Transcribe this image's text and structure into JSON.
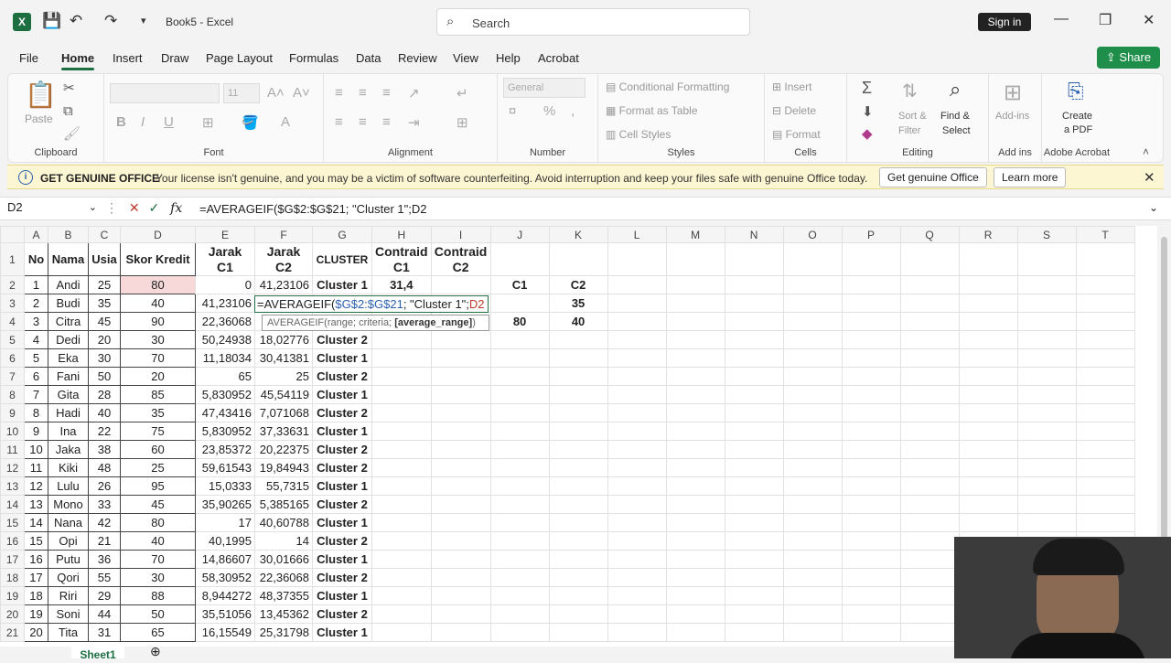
{
  "app": {
    "logo": "X",
    "title": "Book5  -  Excel",
    "search_placeholder": "Search",
    "sign_in": "Sign in"
  },
  "menu": [
    "File",
    "Home",
    "Insert",
    "Draw",
    "Page Layout",
    "Formulas",
    "Data",
    "Review",
    "View",
    "Help",
    "Acrobat"
  ],
  "share": "Share",
  "ribbon": {
    "clipboard": {
      "paste": "Paste",
      "label": "Clipboard"
    },
    "font": {
      "size": "11",
      "bold": "B",
      "italic": "I",
      "underline": "U",
      "label": "Font"
    },
    "alignment": {
      "label": "Alignment"
    },
    "number": {
      "format": "General",
      "label": "Number"
    },
    "styles": {
      "conditional": "Conditional Formatting",
      "table": "Format as Table",
      "cell": "Cell Styles",
      "label": "Styles"
    },
    "cells": {
      "insert": "Insert",
      "delete": "Delete",
      "format": "Format",
      "label": "Cells"
    },
    "editing": {
      "sort": "Sort &",
      "filter": "Filter",
      "find": "Find &",
      "select": "Select",
      "label": "Editing"
    },
    "addins": {
      "btn": "Add-ins",
      "label": "Add ins"
    },
    "acrobat": {
      "line1": "Create",
      "line2": "a PDF",
      "label": "Adobe Acrobat"
    }
  },
  "infobar": {
    "title": "GET GENUINE OFFICE",
    "text": "Your license isn't genuine, and you may be a victim of software counterfeiting. Avoid interruption and keep your files safe with genuine Office today.",
    "btn1": "Get genuine Office",
    "btn2": "Learn more"
  },
  "formula_bar": {
    "namebox": "D2",
    "formula": "=AVERAGEIF($G$2:$G$21; \"Cluster 1\";D2"
  },
  "columns": [
    "A",
    "B",
    "C",
    "D",
    "E",
    "F",
    "G",
    "H",
    "I",
    "J",
    "K",
    "L",
    "M",
    "N",
    "O",
    "P",
    "Q",
    "R",
    "S",
    "T"
  ],
  "headers": {
    "A": "No",
    "B": "Nama",
    "C": "Usia",
    "D": "Skor Kredit",
    "E1": "Jarak",
    "E2": "C1",
    "F1": "Jarak",
    "F2": "C2",
    "G": "CLUSTER",
    "H1": "Contraid",
    "H2": "C1",
    "I1": "Contraid",
    "I2": "C2"
  },
  "rows": [
    [
      "1",
      "Andi",
      "25",
      "80",
      "0",
      "41,23106",
      "Cluster 1"
    ],
    [
      "2",
      "Budi",
      "35",
      "40",
      "41,23106",
      "",
      ""
    ],
    [
      "3",
      "Citra",
      "45",
      "90",
      "22,36068",
      "",
      ""
    ],
    [
      "4",
      "Dedi",
      "20",
      "30",
      "50,24938",
      "18,02776",
      "Cluster 2"
    ],
    [
      "5",
      "Eka",
      "30",
      "70",
      "11,18034",
      "30,41381",
      "Cluster 1"
    ],
    [
      "6",
      "Fani",
      "50",
      "20",
      "65",
      "25",
      "Cluster 2"
    ],
    [
      "7",
      "Gita",
      "28",
      "85",
      "5,830952",
      "45,54119",
      "Cluster 1"
    ],
    [
      "8",
      "Hadi",
      "40",
      "35",
      "47,43416",
      "7,071068",
      "Cluster 2"
    ],
    [
      "9",
      "Ina",
      "22",
      "75",
      "5,830952",
      "37,33631",
      "Cluster 1"
    ],
    [
      "10",
      "Jaka",
      "38",
      "60",
      "23,85372",
      "20,22375",
      "Cluster 2"
    ],
    [
      "11",
      "Kiki",
      "48",
      "25",
      "59,61543",
      "19,84943",
      "Cluster 2"
    ],
    [
      "12",
      "Lulu",
      "26",
      "95",
      "15,0333",
      "55,7315",
      "Cluster 1"
    ],
    [
      "13",
      "Mono",
      "33",
      "45",
      "35,90265",
      "5,385165",
      "Cluster 2"
    ],
    [
      "14",
      "Nana",
      "42",
      "80",
      "17",
      "40,60788",
      "Cluster 1"
    ],
    [
      "15",
      "Opi",
      "21",
      "40",
      "40,1995",
      "14",
      "Cluster 2"
    ],
    [
      "16",
      "Putu",
      "36",
      "70",
      "14,86607",
      "30,01666",
      "Cluster 1"
    ],
    [
      "17",
      "Qori",
      "55",
      "30",
      "58,30952",
      "22,36068",
      "Cluster 2"
    ],
    [
      "18",
      "Riri",
      "29",
      "88",
      "8,944272",
      "48,37355",
      "Cluster 1"
    ],
    [
      "19",
      "Soni",
      "44",
      "50",
      "35,51056",
      "13,45362",
      "Cluster 2"
    ],
    [
      "20",
      "Tita",
      "31",
      "65",
      "16,15549",
      "25,31798",
      "Cluster 1"
    ]
  ],
  "centroid": {
    "h2": "31,4",
    "j2": "C1",
    "k2": "C2",
    "k3": "35",
    "j4": "80",
    "k4": "40"
  },
  "edit": {
    "prefix": "=AVERAGEIF(",
    "range": "$G$2:$G$21",
    "middle": "; \"Cluster 1\";",
    "ref": "D2"
  },
  "tooltip": {
    "fn": "AVERAGEIF",
    "args": "(range; criteria; ",
    "bold": "[average_range]",
    "end": ")"
  },
  "sheet_tab": "Sheet1"
}
